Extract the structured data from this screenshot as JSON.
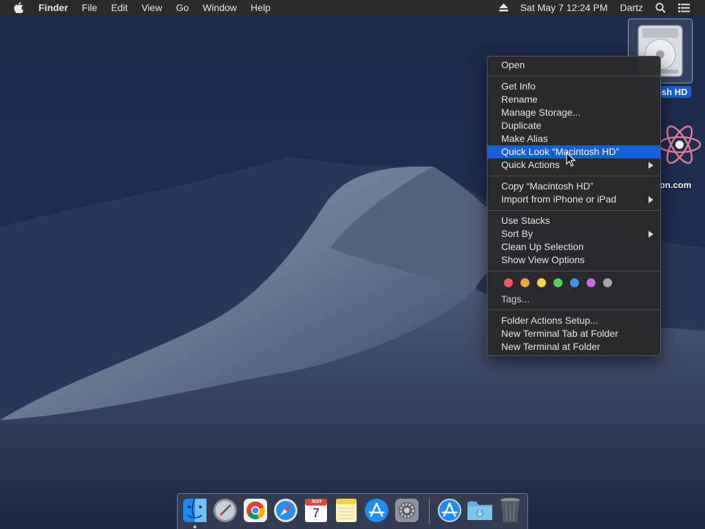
{
  "menubar": {
    "items": [
      "Finder",
      "File",
      "Edit",
      "View",
      "Go",
      "Window",
      "Help"
    ],
    "datetime": "Sat May 7  12:24 PM",
    "user": "Dartz"
  },
  "desktop": {
    "hd_label": "osh HD",
    "atom_label": "gon.com"
  },
  "context_menu": {
    "open": "Open",
    "get_info": "Get Info",
    "rename": "Rename",
    "manage_storage": "Manage Storage...",
    "duplicate": "Duplicate",
    "make_alias": "Make Alias",
    "quick_look": "Quick Look “Macintosh HD”",
    "quick_actions": "Quick Actions",
    "copy": "Copy “Macintosh HD”",
    "import_iphone": "Import from iPhone or iPad",
    "use_stacks": "Use Stacks",
    "sort_by": "Sort By",
    "clean_up": "Clean Up Selection",
    "show_view_options": "Show View Options",
    "tags_label": "Tags...",
    "folder_actions": "Folder Actions Setup...",
    "new_terminal_tab": "New Terminal Tab at Folder",
    "new_terminal": "New Terminal at Folder",
    "tag_colors": [
      "#ee5a5a",
      "#f3a33a",
      "#f2d63a",
      "#5ad25a",
      "#3a9af2",
      "#c66ae8",
      "#a8a8ac"
    ]
  },
  "dock": {
    "calendar_month": "MAY",
    "calendar_day": "7",
    "apps": [
      "finder-icon",
      "launchpad-icon",
      "chrome-icon",
      "safari-icon",
      "calendar-icon",
      "notes-icon",
      "app-store-icon",
      "system-preferences-icon",
      "app-store-download-icon",
      "downloads-folder-icon",
      "trash-icon"
    ]
  }
}
